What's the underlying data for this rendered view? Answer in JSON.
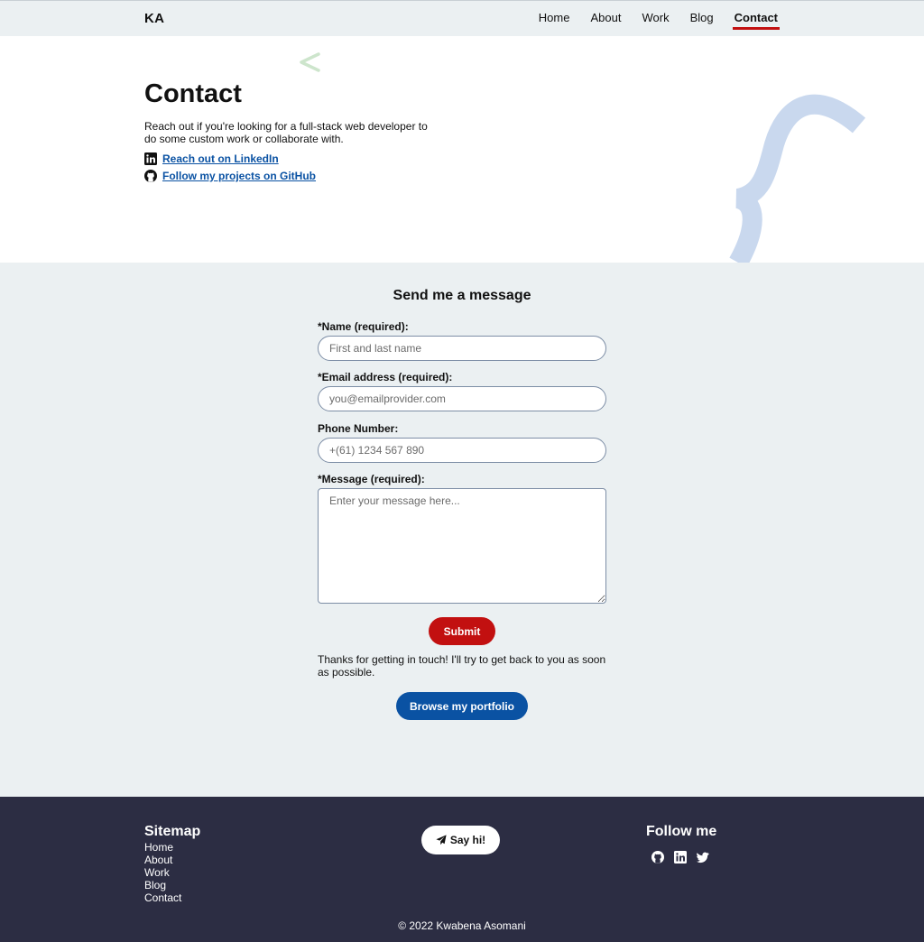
{
  "nav": {
    "logo": "KA",
    "links": [
      "Home",
      "About",
      "Work",
      "Blog",
      "Contact"
    ],
    "active": "Contact"
  },
  "hero": {
    "title": "Contact",
    "description": "Reach out if you're looking for a full-stack web developer to do some custom work or collaborate with.",
    "linkedin_link": "Reach out on LinkedIn",
    "github_link": "Follow my projects on GitHub",
    "icons": [
      "linkedin-icon",
      "github-icon"
    ]
  },
  "form": {
    "title": "Send me a message",
    "name": {
      "label": "*Name (required):",
      "value": "",
      "placeholder": "First and last name"
    },
    "email": {
      "label": "*Email address (required):",
      "value": "",
      "placeholder": "you@emailprovider.com"
    },
    "phone": {
      "label": "Phone Number:",
      "value": "",
      "placeholder": "+(61) 1234 567 890"
    },
    "message": {
      "label": "*Message (required):",
      "value": "",
      "placeholder": "Enter your message here..."
    },
    "submit_label": "Submit",
    "thanks": "Thanks for getting in touch! I'll try to get back to you as soon as possible.",
    "portfolio_label": "Browse my portfolio"
  },
  "footer": {
    "sitemap_title": "Sitemap",
    "sitemap_links": [
      "Home",
      "About",
      "Work",
      "Blog",
      "Contact"
    ],
    "say_hi": "Say hi!",
    "follow_title": "Follow me",
    "social_icons": [
      "github-icon",
      "linkedin-icon",
      "twitter-icon"
    ],
    "copyright": "© 2022 Kwabena Asomani"
  },
  "colors": {
    "accent_red": "#c21010",
    "accent_blue": "#0a52a3",
    "footer_bg": "#2c2d43",
    "section_bg": "#ebf0f2"
  }
}
